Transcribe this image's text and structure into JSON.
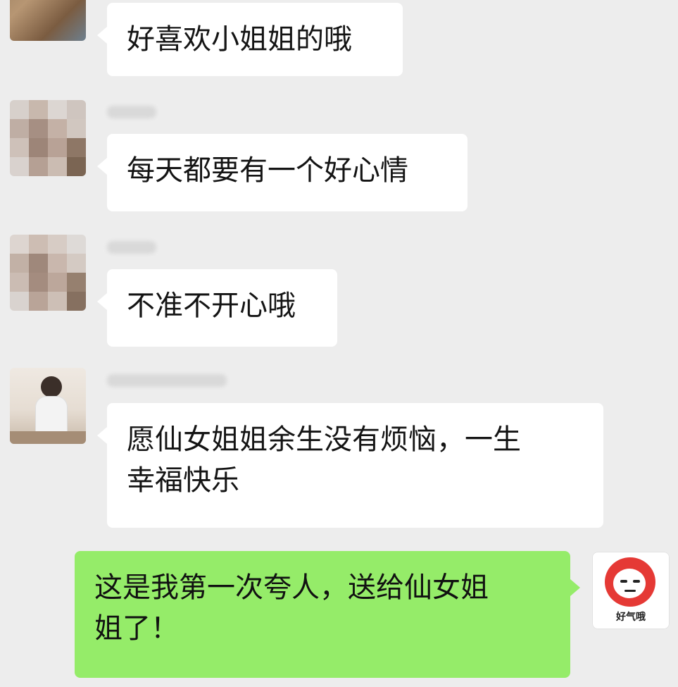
{
  "messages": [
    {
      "sender": "other",
      "text": "好喜欢小姐姐的哦"
    },
    {
      "sender": "other",
      "text": "每天都要有一个好心情"
    },
    {
      "sender": "other",
      "text": "不准不开心哦"
    },
    {
      "sender": "other",
      "text": "愿仙女姐姐余生没有烦恼，一生\n幸福快乐"
    },
    {
      "sender": "self",
      "text": "这是我第一次夸人，送给仙女姐\n姐了！"
    }
  ],
  "sticker": {
    "label": "好气哦",
    "accent": "#e53935"
  },
  "colors": {
    "background": "#ededed",
    "incoming_bubble": "#ffffff",
    "outgoing_bubble": "#95ec69"
  }
}
